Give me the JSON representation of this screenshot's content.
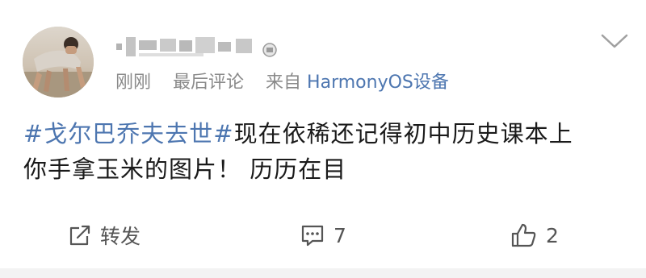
{
  "post": {
    "time": "刚刚",
    "sort_label": "最后评论",
    "source_prefix": "来自",
    "source_device": "HarmonyOS设备",
    "topic": "#戈尔巴乔夫去世#",
    "text_line1": "现在依稀还记得初中历史课本上",
    "text_line2": "你手拿玉米的图片！ 历历在目"
  },
  "actions": {
    "repost_label": "转发",
    "comment_count": "7",
    "like_count": "2"
  },
  "icons": {
    "more": "chevron-down-icon",
    "repost": "share-icon",
    "comment": "comment-icon",
    "like": "thumbs-up-icon",
    "verify": "badge-icon"
  },
  "colors": {
    "link": "#4d76b0",
    "meta": "#8a8a8a",
    "text": "#1a1a1a",
    "icon": "#555555"
  }
}
